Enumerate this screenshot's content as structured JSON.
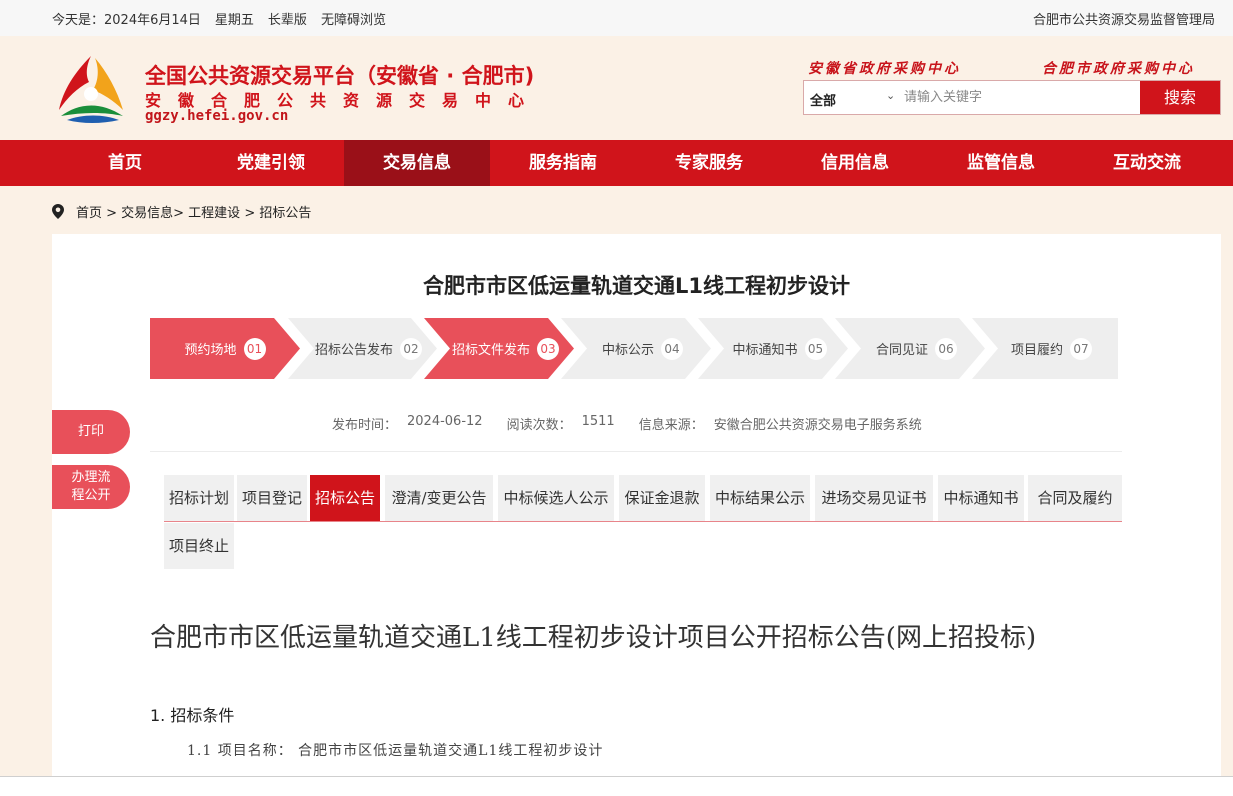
{
  "topbar": {
    "date": "今天是：2024年6月14日",
    "weekday": "星期五",
    "elder_mode": "长辈版",
    "accessibility": "无障碍浏览",
    "authority": "合肥市公共资源交易监督管理局"
  },
  "header": {
    "title": "全国公共资源交易平台（安徽省 · 合肥市)",
    "subtitle": "安徽合肥公共资源交易中心",
    "url": "ggzy.hefei.gov.cn",
    "link_province": "安徽省政府采购中心",
    "link_city": "合肥市政府采购中心",
    "search": {
      "category": "全部",
      "placeholder": "请输入关键字",
      "button": "搜索"
    }
  },
  "nav": {
    "items": [
      "首页",
      "党建引领",
      "交易信息",
      "服务指南",
      "专家服务",
      "信用信息",
      "监管信息",
      "互动交流"
    ],
    "active": "交易信息"
  },
  "breadcrumb": {
    "text": "首页 > 交易信息> 工程建设 > 招标公告"
  },
  "article": {
    "title": "合肥市市区低运量轨道交通L1线工程初步设计",
    "steps": [
      {
        "label": "预约场地",
        "num": "01",
        "active": true
      },
      {
        "label": "招标公告发布",
        "num": "02",
        "active": false
      },
      {
        "label": "招标文件发布",
        "num": "03",
        "active": true
      },
      {
        "label": "中标公示",
        "num": "04",
        "active": false
      },
      {
        "label": "中标通知书",
        "num": "05",
        "active": false
      },
      {
        "label": "合同见证",
        "num": "06",
        "active": false
      },
      {
        "label": "项目履约",
        "num": "07",
        "active": false
      }
    ],
    "meta": {
      "publish_label": "发布时间：",
      "publish_value": "2024-06-12",
      "views_label": "阅读次数：",
      "views_value": "1511",
      "source_label": "信息来源：",
      "source_value": "安徽合肥公共资源交易电子服务系统"
    },
    "tabs": [
      "招标计划",
      "项目登记",
      "招标公告",
      "澄清/变更公告",
      "中标候选人公示",
      "保证金退款",
      "中标结果公示",
      "进场交易见证书",
      "中标通知书",
      "合同及履约",
      "项目终止"
    ],
    "active_tab": "招标公告",
    "doc_title": "合肥市市区低运量轨道交通L1线工程初步设计项目公开招标公告(网上招投标)",
    "section_heading": "1.  招标条件",
    "section_item": "1.1  项目名称：  合肥市市区低运量轨道交通L1线工程初步设计"
  },
  "side": {
    "print": "打印",
    "process_line1": "办理流",
    "process_line2": "程公开"
  },
  "colors": {
    "brand_red": "#d0141b",
    "nav_active": "#9a1018",
    "step_active": "#e8505a",
    "step_inactive": "#eeeeee",
    "header_bg": "#fbf1e6"
  }
}
